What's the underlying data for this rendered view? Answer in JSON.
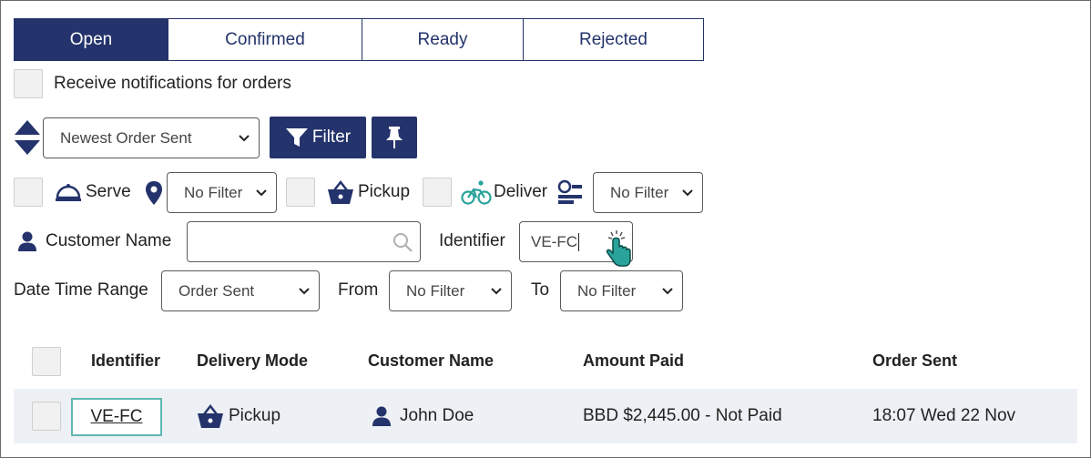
{
  "tabs": [
    {
      "label": "Open",
      "active": true
    },
    {
      "label": "Confirmed",
      "active": false
    },
    {
      "label": "Ready",
      "active": false
    },
    {
      "label": "Rejected",
      "active": false
    }
  ],
  "notifications": {
    "label": "Receive notifications for orders"
  },
  "sort": {
    "selected": "Newest Order Sent",
    "icon": "sort-arrows-icon"
  },
  "filter_button": {
    "label": "Filter",
    "icon": "funnel-icon"
  },
  "pin_button": {
    "icon": "pin-icon"
  },
  "modes": {
    "serve_label": "Serve",
    "location_filter": "No Filter",
    "pickup_label": "Pickup",
    "deliver_label": "Deliver",
    "status_filter": "No Filter"
  },
  "search": {
    "customer_label": "Customer Name",
    "customer_value": "",
    "identifier_label": "Identifier",
    "identifier_value": "VE-FC"
  },
  "date_range": {
    "label": "Date Time Range",
    "selected": "Order Sent",
    "from_label": "From",
    "from_value": "No Filter",
    "to_label": "To",
    "to_value": "No Filter"
  },
  "table": {
    "columns": [
      "Identifier",
      "Delivery Mode",
      "Customer Name",
      "Amount Paid",
      "Order Sent"
    ],
    "rows": [
      {
        "identifier": "VE-FC",
        "mode": "Pickup",
        "customer": "John Doe",
        "amount": "BBD $2,445.00 - Not Paid",
        "sent": "18:07 Wed 22 Nov"
      }
    ]
  },
  "colors": {
    "navy": "#24336b",
    "teal": "#2aa39a",
    "row_bg": "#edf0f4"
  }
}
